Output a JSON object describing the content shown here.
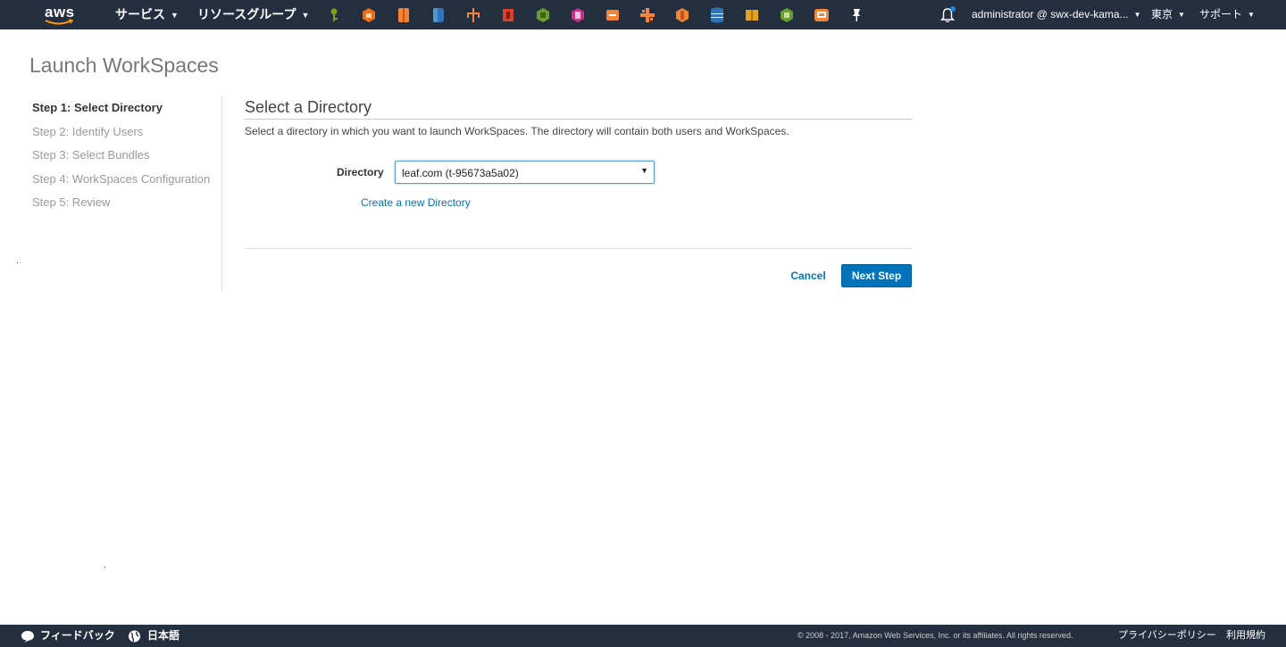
{
  "topnav": {
    "logo_text": "aws",
    "services_label": "サービス",
    "resource_groups_label": "リソースグループ",
    "service_icons": [
      {
        "name": "key-icon",
        "color": "#7aa116"
      },
      {
        "name": "shield-icon",
        "color": "#e7711b"
      },
      {
        "name": "compute-icon",
        "color": "#f58536"
      },
      {
        "name": "database-icon",
        "color": "#2e73b8"
      },
      {
        "name": "network-icon",
        "color": "#f58536"
      },
      {
        "name": "security-icon",
        "color": "#d9412b"
      },
      {
        "name": "cube-icon",
        "color": "#6b9e31"
      },
      {
        "name": "mobile-icon",
        "color": "#c92f8f"
      },
      {
        "name": "routing-icon",
        "color": "#f58536"
      },
      {
        "name": "cross-icon",
        "color": "#f58536"
      },
      {
        "name": "storage-icon",
        "color": "#f58536"
      },
      {
        "name": "database-stack-icon",
        "color": "#2e73b8"
      },
      {
        "name": "box-icon",
        "color": "#e3a21a"
      },
      {
        "name": "shield-green-icon",
        "color": "#6b9e31"
      },
      {
        "name": "workspaces-icon",
        "color": "#f58536"
      },
      {
        "name": "pin-icon",
        "color": "#ffffff"
      }
    ],
    "account_label": "administrator @ swx-dev-kama...",
    "region_label": "東京",
    "support_label": "サポート"
  },
  "page": {
    "title": "Launch WorkSpaces"
  },
  "steps": [
    {
      "label": "Step 1: Select Directory",
      "active": true
    },
    {
      "label": "Step 2: Identify Users",
      "active": false
    },
    {
      "label": "Step 3: Select Bundles",
      "active": false
    },
    {
      "label": "Step 4: WorkSpaces Configuration",
      "active": false
    },
    {
      "label": "Step 5: Review",
      "active": false
    }
  ],
  "panel": {
    "title": "Select a Directory",
    "description": "Select a directory in which you want to launch WorkSpaces. The directory will contain both users and WorkSpaces.",
    "directory_label": "Directory",
    "directory_value": "leaf.com (t-95673a5a02)",
    "create_link": "Create a new Directory",
    "cancel_label": "Cancel",
    "next_label": "Next Step"
  },
  "footer": {
    "feedback_label": "フィードバック",
    "language_label": "日本語",
    "copyright": "© 2008 - 2017, Amazon Web Services, Inc. or its affiliates. All rights reserved.",
    "privacy_label": "プライバシーポリシー",
    "terms_label": "利用規約"
  },
  "colors": {
    "nav_bg": "#232f3e",
    "primary": "#0073bb",
    "link": "#0073bb"
  }
}
